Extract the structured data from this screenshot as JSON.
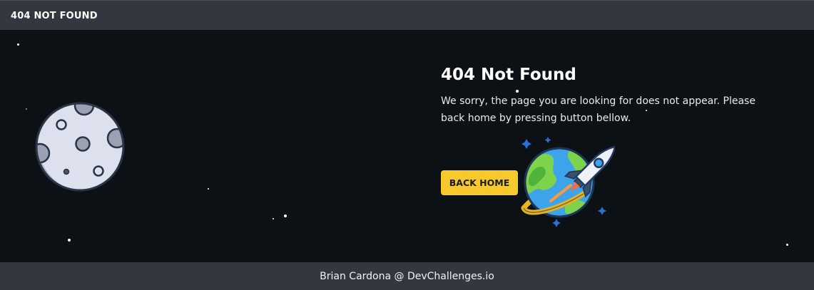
{
  "header": {
    "title": "404 NOT FOUND"
  },
  "content": {
    "heading": "404 Not Found",
    "message": "We sorry, the page you are looking for does not appear. Please back home by pressing button bellow.",
    "button_label": "BACK HOME"
  },
  "footer": {
    "credit": "Brian Cardona @ DevChallenges.io"
  },
  "illustrations": {
    "left": "moon-icon",
    "right": "planet-rocket-icon"
  },
  "colors": {
    "background": "#0c1116",
    "bar": "#33373f",
    "button": "#f8c92a",
    "button_text": "#1b1b1b"
  }
}
